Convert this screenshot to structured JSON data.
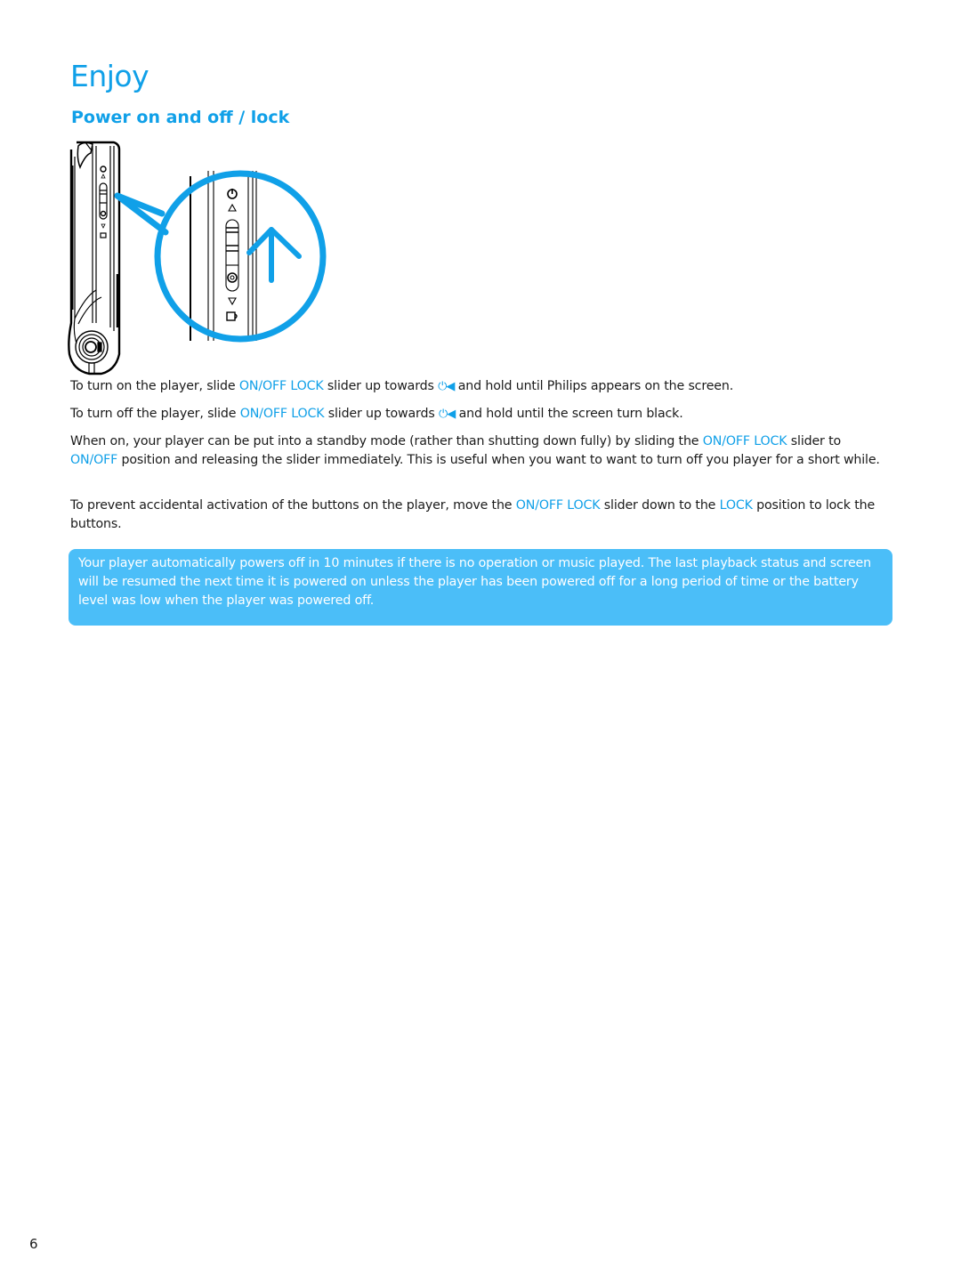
{
  "page": {
    "title": "Enjoy",
    "section_title": "Power on and off / lock",
    "page_number": "6"
  },
  "colors": {
    "accent": "#10a0e8",
    "note_background": "#4bbef8",
    "note_text": "#ffffff",
    "body_text": "#1a1a1a"
  },
  "illustration": {
    "description": "Side view of player with magnified ON/OFF LOCK slider and upward arrow",
    "icons": [
      "power-icon",
      "up-triangle-icon",
      "slider-switch",
      "down-triangle-icon",
      "lock-icon",
      "up-arrow-icon",
      "magnifier-callout"
    ]
  },
  "paragraphs": {
    "p1": {
      "a": "To turn on the player, slide ",
      "b": "ON/OFF LOCK",
      "c": " slider up towards ",
      "icon": "⏻◀",
      "d": " and hold until Philips appears on the screen."
    },
    "p2": {
      "a": "To turn off the player, slide ",
      "b": "ON/OFF LOCK",
      "c": " slider up towards ",
      "icon": "⏻◀",
      "d": " and hold until the screen turn black."
    },
    "p3": {
      "a": "When on, your player can be put into a standby mode (rather than shutting down fully) by sliding the ",
      "b": "ON/OFF LOCK",
      "c": " slider to ",
      "d": "ON/OFF",
      "e": " position and releasing the slider immediately. This is useful when you want to want to turn off you player for a short while."
    },
    "p4": {
      "a": "To prevent accidental activation of the buttons on the player, move the ",
      "b": "ON/OFF LOCK",
      "c": " slider down to the ",
      "d": "LOCK",
      "e": " position to lock the buttons."
    }
  },
  "note": {
    "text": "Your player automatically powers off in 10 minutes if there is no operation or music played. The last playback status and screen will be resumed the next time it is powered on unless the player has been powered off for a long period of time or the battery level was low when the player was powered off."
  }
}
